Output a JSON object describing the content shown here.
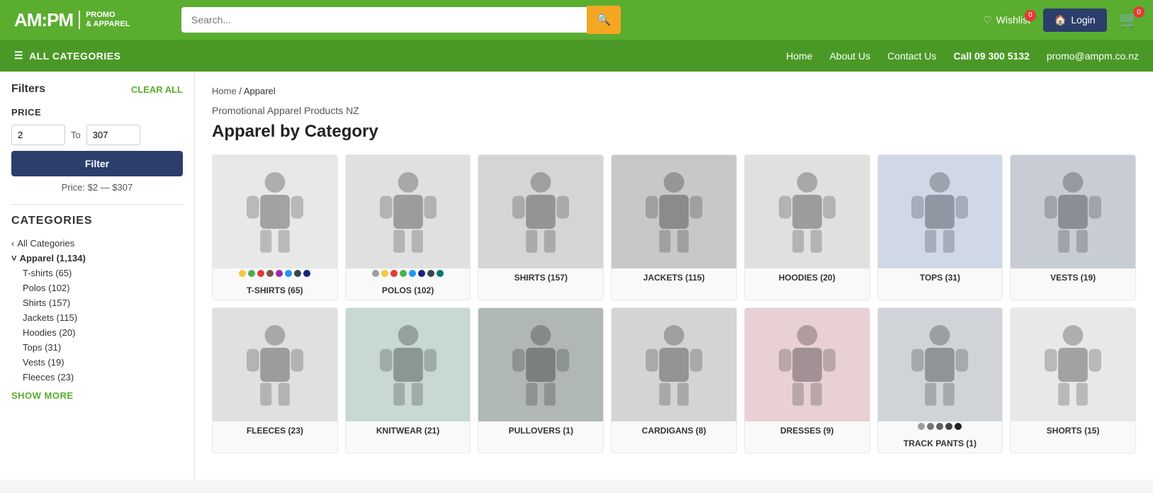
{
  "header": {
    "logo_main": "AM:PM",
    "logo_sub_line1": "PROMO",
    "logo_sub_line2": "& APPAREL",
    "search_placeholder": "Search...",
    "search_btn_icon": "🔍",
    "wishlist_label": "Wishlist",
    "wishlist_badge": "0",
    "login_label": "Login",
    "cart_badge": "0"
  },
  "navbar": {
    "all_categories": "ALL CATEGORIES",
    "links": [
      {
        "label": "Home"
      },
      {
        "label": "About Us"
      },
      {
        "label": "Contact Us"
      }
    ],
    "phone": "Call 09 300 5132",
    "email": "promo@ampm.co.nz"
  },
  "sidebar": {
    "filters_title": "Filters",
    "clear_all": "CLEAR ALL",
    "price_section_title": "PRICE",
    "price_min": "2",
    "price_max": "307",
    "price_to_label": "To",
    "filter_btn_label": "Filter",
    "price_range_text": "Price: $2 — $307",
    "categories_title": "CATEGORIES",
    "all_categories_item": "All Categories",
    "apparel_item": "Apparel (1,134)",
    "sub_categories": [
      {
        "label": "T-shirts (65)"
      },
      {
        "label": "Polos (102)"
      },
      {
        "label": "Shirts (157)"
      },
      {
        "label": "Jackets (115)"
      },
      {
        "label": "Hoodies (20)"
      },
      {
        "label": "Tops (31)"
      },
      {
        "label": "Vests (19)"
      },
      {
        "label": "Fleeces (23)"
      }
    ],
    "show_more": "SHOW MORE"
  },
  "main": {
    "breadcrumb_home": "Home",
    "breadcrumb_sep": "/",
    "breadcrumb_current": "Apparel",
    "page_subtitle": "Promotional Apparel Products NZ",
    "page_title": "Apparel by Category",
    "products_row1": [
      {
        "label": "T-SHIRTS (65)",
        "bg": "#e8e8e8",
        "figure_color": "#555",
        "colors": [
          "#f5c842",
          "#4caf50",
          "#e53935",
          "#795548",
          "#9c27b0",
          "#2196f3",
          "#37474f",
          "#1a237e"
        ]
      },
      {
        "label": "POLOS (102)",
        "bg": "#e0e0e0",
        "colors": [
          "#9e9e9e",
          "#f5c842",
          "#e53935",
          "#4caf50",
          "#2196f3",
          "#1a237e",
          "#37474f",
          "#00796b"
        ]
      },
      {
        "label": "SHIRTS (157)",
        "bg": "#d5d5d5",
        "colors": []
      },
      {
        "label": "JACKETS (115)",
        "bg": "#c8c8c8",
        "colors": []
      },
      {
        "label": "HOODIES (20)",
        "bg": "#e0e0e0",
        "colors": []
      },
      {
        "label": "TOPS (31)",
        "bg": "#d0d8e8",
        "colors": []
      },
      {
        "label": "VESTS (19)",
        "bg": "#c8ccd4",
        "colors": []
      }
    ],
    "products_row2": [
      {
        "label": "FLEECES (23)",
        "bg": "#e0e0e0",
        "colors": []
      },
      {
        "label": "KNITWEAR (21)",
        "bg": "#c8d8d4",
        "colors": []
      },
      {
        "label": "PULLOVERS (1)",
        "bg": "#b0b8b4",
        "colors": []
      },
      {
        "label": "CARDIGANS (8)",
        "bg": "#d4d4d4",
        "colors": []
      },
      {
        "label": "DRESSES (9)",
        "bg": "#e8d0d4",
        "colors": []
      },
      {
        "label": "TRACK PANTS (1)",
        "bg": "#d0d4d8",
        "colors": [
          "#9e9e9e",
          "#757575",
          "#616161",
          "#424242",
          "#212121"
        ]
      },
      {
        "label": "SHORTS (15)",
        "bg": "#e8e8e8",
        "colors": []
      }
    ]
  }
}
